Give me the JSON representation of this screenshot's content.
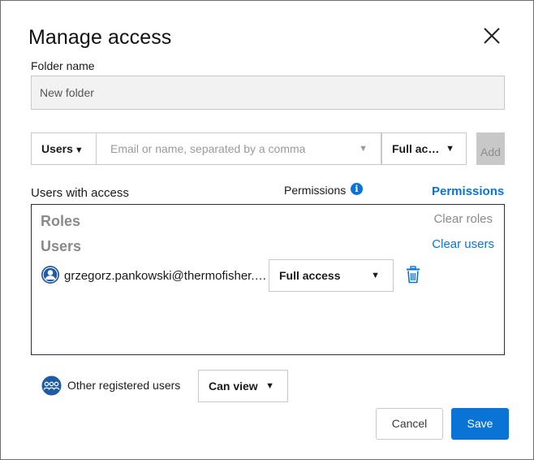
{
  "dialog": {
    "title": "Manage access"
  },
  "folder": {
    "label": "Folder name",
    "value": "New folder"
  },
  "add_row": {
    "type_select": "Users",
    "email_placeholder": "Email or name, separated by a comma",
    "permission_select": "Full ac…",
    "add_label": "Add"
  },
  "access_list": {
    "heading": "Users with access",
    "permissions_header": "Permissions",
    "permissions_link": "Permissions",
    "roles_heading": "Roles",
    "clear_roles": "Clear roles",
    "users_heading": "Users",
    "clear_users": "Clear users",
    "users": [
      {
        "email": "grzegorz.pankowski@thermofisher.com",
        "permission": "Full access"
      }
    ]
  },
  "others": {
    "label": "Other registered users",
    "permission": "Can view"
  },
  "footer": {
    "cancel_label": "Cancel",
    "save_label": "Save"
  },
  "colors": {
    "accent": "#0a74d6",
    "muted": "#8a8a8a"
  },
  "icons": [
    "close-icon",
    "chevron-down-icon",
    "info-icon",
    "user-avatar-icon",
    "trash-icon",
    "group-icon"
  ]
}
